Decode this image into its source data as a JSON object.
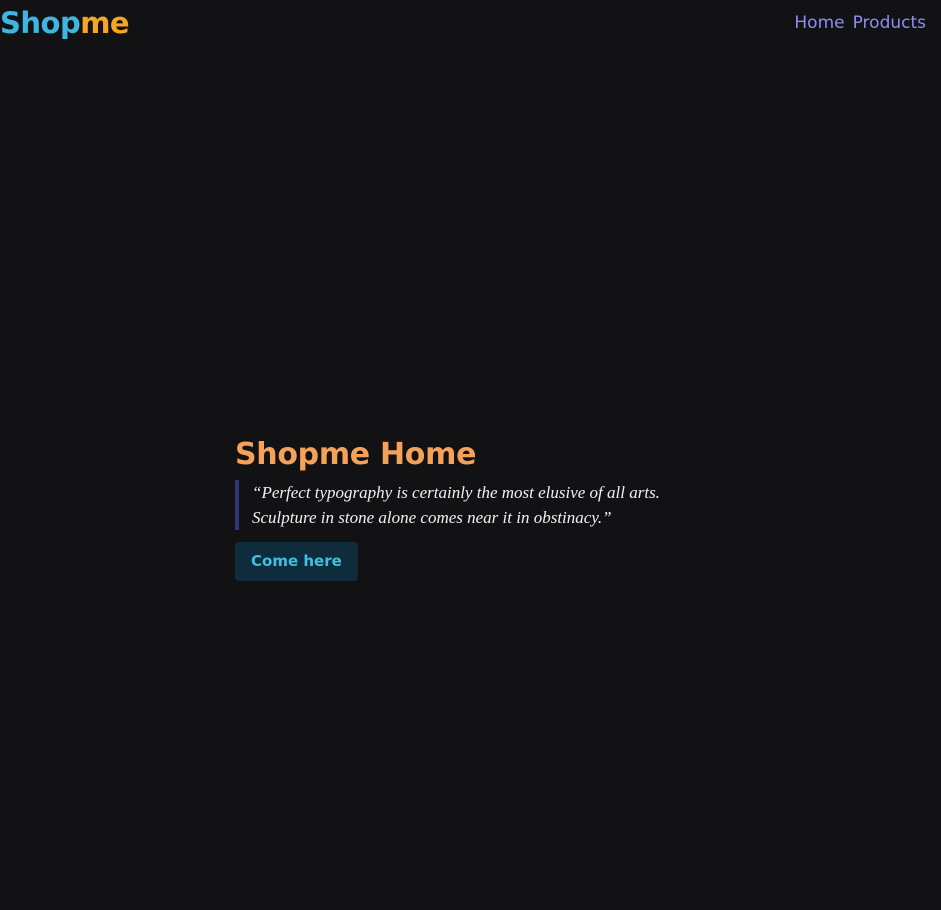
{
  "header": {
    "logo_part1": "Shop",
    "logo_part2": "me",
    "nav": [
      {
        "label": "Home"
      },
      {
        "label": "Products"
      }
    ]
  },
  "hero": {
    "title": "Shopme Home",
    "quote_line1": "“Perfect typography is certainly the most elusive of all arts.",
    "quote_line2": "Sculpture in stone alone comes near it in obstinacy.”",
    "cta_label": "Come here"
  },
  "colors": {
    "background": "#121214",
    "logo_primary": "#3fb6e0",
    "logo_accent": "#f5a623",
    "nav_link": "#8f8cf5",
    "title": "#f4a25a",
    "quote_border": "#2e3a78",
    "cta_bg": "#0f2c3d",
    "cta_text": "#3ec1e0"
  }
}
